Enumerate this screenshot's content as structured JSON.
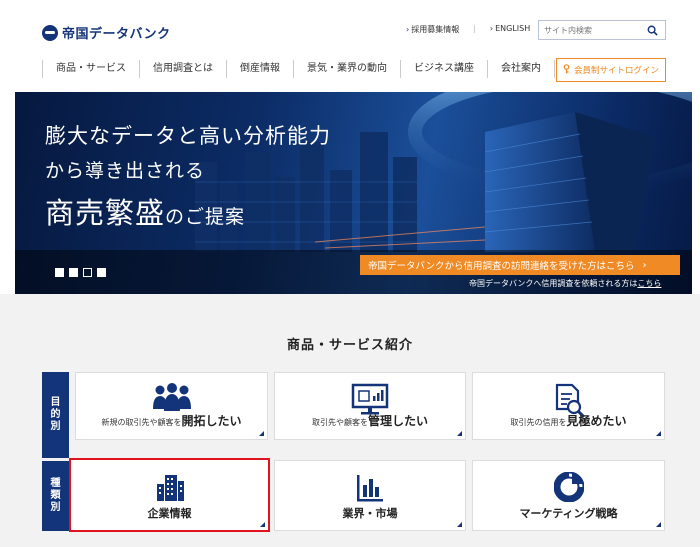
{
  "header": {
    "logo_text": "帝国データバンク",
    "links": [
      {
        "label": "採用募集情報"
      },
      {
        "label": "ENGLISH"
      }
    ],
    "search_placeholder": "サイト内検索",
    "nav": [
      "商品・サービス",
      "信用調査とは",
      "倒産情報",
      "景気・業界の動向",
      "ビジネス講座",
      "会社案内"
    ],
    "login_label": "会員制サイトログイン"
  },
  "hero": {
    "line1": "膨大なデータと高い分析能力",
    "line2": "から導き出される",
    "line3_big": "商売繁盛",
    "line3_small": "のご提案",
    "banner_text": "帝国データバンクから信用調査の訪問連絡を受けた方はこちら",
    "request_text": "帝国データバンクへ信用調査を依頼される方は",
    "request_link": "こちら",
    "slide_count": 4,
    "active_slide": 3
  },
  "products": {
    "title": "商品・サービス紹介",
    "row1_label": [
      "目",
      "的",
      "別"
    ],
    "row2_label": [
      "種",
      "類",
      "別"
    ],
    "purpose_cards": [
      {
        "small": "新規の取引先や顧客を",
        "big": "開拓したい",
        "icon": "people-group-icon"
      },
      {
        "small": "取引先や顧客を",
        "big": "管理したい",
        "icon": "monitor-chart-icon"
      },
      {
        "small": "取引先の信用を",
        "big": "見極めたい",
        "icon": "document-magnifier-icon"
      }
    ],
    "type_cards": [
      {
        "label": "企業情報",
        "icon": "building-icon"
      },
      {
        "label": "業界・市場",
        "icon": "bar-chart-icon"
      },
      {
        "label": "マーケティング戦略",
        "icon": "pie-chart-icon"
      }
    ]
  },
  "colors": {
    "brand_navy": "#14347a",
    "accent_orange": "#f08a24",
    "highlight_red": "#e0141e"
  }
}
